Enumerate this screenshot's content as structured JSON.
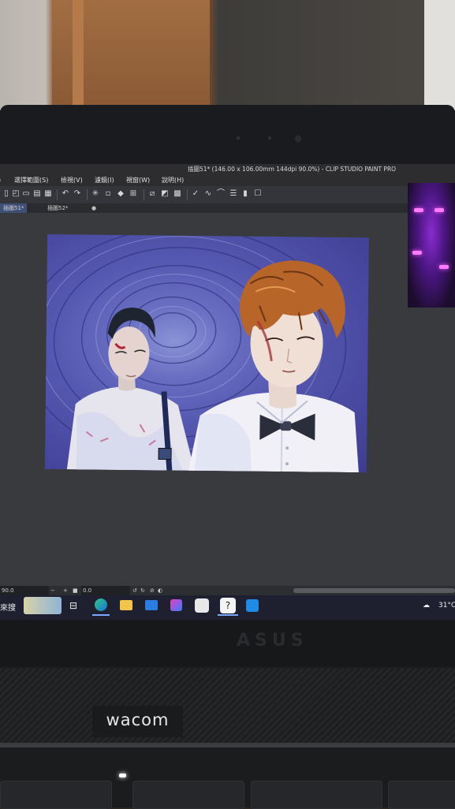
{
  "window": {
    "title": "插圖51* (146.00 x 106.00mm 144dpi 90.0%) - CLIP STUDIO PAINT PRO"
  },
  "menu": {
    "items": [
      "選擇範圍(S)",
      "檢視(V)",
      "濾鏡(I)",
      "視窗(W)",
      "說明(H)"
    ]
  },
  "tabs": [
    {
      "label": "插圖51*",
      "active": true
    },
    {
      "label": "插圖52*",
      "active": false
    }
  ],
  "status": {
    "zoom": "90.0",
    "angle": "0.0"
  },
  "taskbar": {
    "search_label": "來搜",
    "weather_temp": "31°C",
    "icons": [
      "widgets-icon",
      "task-view-icon",
      "edge-icon",
      "file-explorer-icon",
      "mail-icon",
      "media-icon",
      "app-icon",
      "clip-studio-icon",
      "photos-icon"
    ]
  },
  "hardware": {
    "tablet_brand": "wacom",
    "laptop_brand": "ASUS"
  }
}
